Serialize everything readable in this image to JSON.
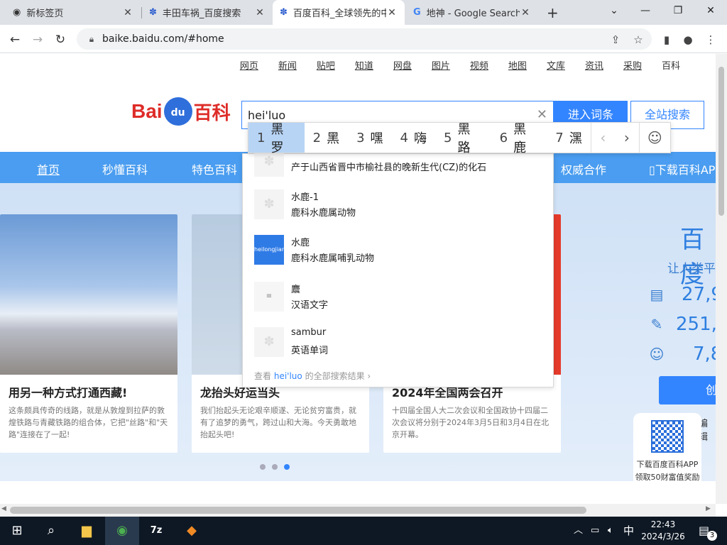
{
  "browser": {
    "tabs": [
      {
        "title": "新标签页",
        "icon": "chrome-icon"
      },
      {
        "title": "丰田车祸_百度搜索",
        "icon": "baidu-paw-icon"
      },
      {
        "title": "百度百科_全球领先的中",
        "icon": "baidu-paw-icon"
      },
      {
        "title": "地神 - Google Search",
        "icon": "google-icon"
      }
    ],
    "url": "baike.baidu.com/#home"
  },
  "topnav": [
    "网页",
    "新闻",
    "贴吧",
    "知道",
    "网盘",
    "图片",
    "视频",
    "地图",
    "文库",
    "资讯",
    "采购",
    "百科"
  ],
  "logo": {
    "part1": "Bai",
    "part2": "du",
    "part3": "百科"
  },
  "search": {
    "value": "hei'luo",
    "enter_button": "进入词条",
    "site_button": "全站搜索"
  },
  "ime": {
    "candidates": [
      {
        "n": "1",
        "text": "黑罗"
      },
      {
        "n": "2",
        "text": "黑"
      },
      {
        "n": "3",
        "text": "嘿"
      },
      {
        "n": "4",
        "text": "嗨"
      },
      {
        "n": "5",
        "text": "黑路"
      },
      {
        "n": "6",
        "text": "黑鹿"
      },
      {
        "n": "7",
        "text": "潶"
      }
    ]
  },
  "suggestions": {
    "items": [
      {
        "title": "",
        "desc": "产于山西省晋中市榆社县的晚新生代(CZ)的化石"
      },
      {
        "title": "水鹿-1",
        "desc": "鹿科水鹿属动物"
      },
      {
        "title": "水鹿",
        "desc": "鹿科水鹿属哺乳动物",
        "thumb_text": "heilongjiang"
      },
      {
        "title": "麎",
        "desc": "汉语文字"
      },
      {
        "title": "sambur",
        "desc": "英语单词"
      }
    ],
    "more_prefix": "查看",
    "more_keyword": "hei'luo",
    "more_suffix": "的全部搜索结果"
  },
  "bluebar": [
    "首页",
    "秒懂百科",
    "特色百科",
    "权威合作",
    "下载百科APP"
  ],
  "cards": [
    {
      "title": "用另一种方式打通西藏!",
      "desc": "这条颇具传奇的线路，就是从敦煌到拉萨的敦煌铁路与青藏铁路的组合体，它把\"丝路\"和\"天路\"连接在了一起!"
    },
    {
      "title": "龙抬头好运当头",
      "desc": "我们抬起头无论艰辛顺遂、无论贫穷富贵，就有了追梦的勇气，跨过山和大海。今天勇敢地抬起头吧!"
    },
    {
      "title": "2024年全国两会召开",
      "desc": "十四届全国人大二次会议和全国政协十四届二次会议将分别于2024年3月5日和3月4日在北京开幕。"
    }
  ],
  "stats": {
    "title": "百度",
    "subtitle": "让人类平",
    "values": [
      "27,9",
      "251,2",
      "7,8"
    ],
    "create_button": "创",
    "edit_label": "编辑"
  },
  "qr": {
    "line1": "下载百度百科APP",
    "line2": "领取50财富值奖励"
  },
  "taskbar": {
    "time": "22:43",
    "date": "2024/3/26",
    "ime_lang": "中",
    "notify_count": "3"
  }
}
